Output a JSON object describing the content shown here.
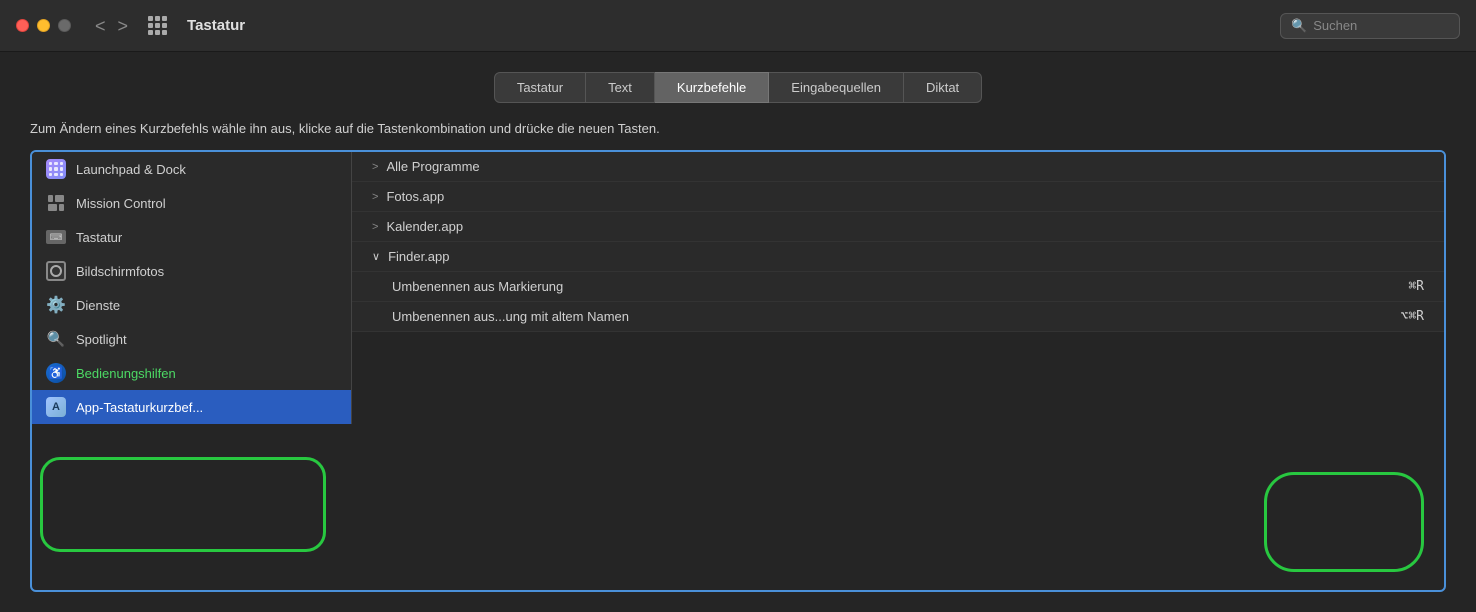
{
  "titlebar": {
    "title": "Tastatur",
    "search_placeholder": "Suchen",
    "nav_back": "<",
    "nav_forward": ">"
  },
  "tabs": [
    {
      "id": "tastatur",
      "label": "Tastatur",
      "active": false
    },
    {
      "id": "text",
      "label": "Text",
      "active": false
    },
    {
      "id": "kurzbefehle",
      "label": "Kurzbefehle",
      "active": true
    },
    {
      "id": "eingabequellen",
      "label": "Eingabequellen",
      "active": false
    },
    {
      "id": "diktat",
      "label": "Diktat",
      "active": false
    }
  ],
  "instructions": "Zum Ändern eines Kurzbefehls wähle ihn aus, klicke auf die Tastenkombination und drücke die neuen Tasten.",
  "sidebar": {
    "items": [
      {
        "id": "launchpad",
        "label": "Launchpad & Dock",
        "icon": "launchpad",
        "selected": false
      },
      {
        "id": "mission",
        "label": "Mission Control",
        "icon": "mission",
        "selected": false
      },
      {
        "id": "tastatur",
        "label": "Tastatur",
        "icon": "keyboard",
        "selected": false
      },
      {
        "id": "bildschirmfotos",
        "label": "Bildschirmfotos",
        "icon": "screenshot",
        "selected": false
      },
      {
        "id": "dienste",
        "label": "Dienste",
        "icon": "gear",
        "selected": false
      },
      {
        "id": "spotlight",
        "label": "Spotlight",
        "icon": "spotlight",
        "selected": false
      },
      {
        "id": "bedienungshilfen",
        "label": "Bedienungshilfen",
        "icon": "accessibility",
        "selected": false,
        "highlighted": true
      },
      {
        "id": "app-tastatur",
        "label": "App-Tastaturkurzbef...",
        "icon": "app",
        "selected": true
      }
    ]
  },
  "right_panel": {
    "items": [
      {
        "id": "alle-programme",
        "label": "Alle Programme",
        "chevron": ">",
        "expanded": false,
        "indent": false
      },
      {
        "id": "fotos",
        "label": "Fotos.app",
        "chevron": ">",
        "expanded": false,
        "indent": false
      },
      {
        "id": "kalender",
        "label": "Kalender.app",
        "chevron": ">",
        "expanded": false,
        "indent": false
      },
      {
        "id": "finder",
        "label": "Finder.app",
        "chevron": "∨",
        "expanded": true,
        "indent": false
      },
      {
        "id": "umbenennen-markierung",
        "label": "Umbenennen aus Markierung",
        "shortcut": "⌘R",
        "indent": true
      },
      {
        "id": "umbenennen-alten-namen",
        "label": "Umbenennen aus...ung mit altem Namen",
        "shortcut": "⌥⌘R",
        "indent": true
      }
    ]
  },
  "colors": {
    "accent_blue": "#2a5dbf",
    "green_annotation": "#28c840",
    "selected_tab_bg": "#636363"
  }
}
